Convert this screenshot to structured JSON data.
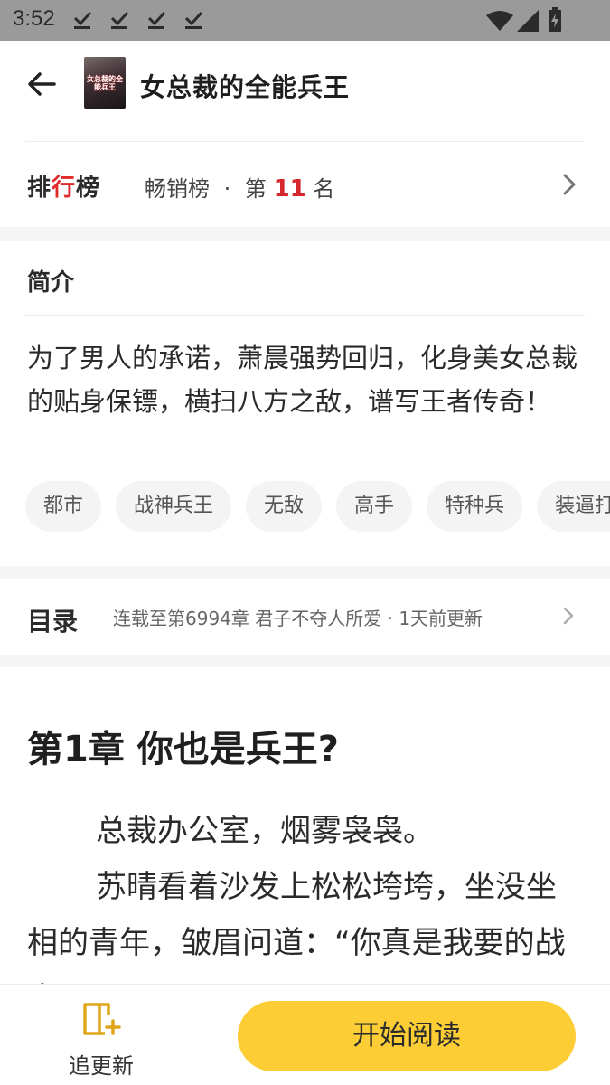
{
  "status_bar": {
    "time": "3:52"
  },
  "header": {
    "book_title": "女总裁的全能兵王",
    "cover_text": "女总裁的全能兵王"
  },
  "ranking": {
    "logo_prefix": "排",
    "logo_accent": "行",
    "logo_suffix": "榜",
    "list_name": "畅销榜",
    "separator": "·",
    "rank_prefix": "第",
    "rank_number": "11",
    "rank_suffix": "名"
  },
  "intro": {
    "title": "简介",
    "text": "为了男人的承诺，萧晨强势回归，化身美女总裁的贴身保镖，横扫八方之敌，谱写王者传奇！",
    "tags": [
      "都市",
      "战神兵王",
      "无敌",
      "高手",
      "特种兵",
      "装逼打脸"
    ]
  },
  "catalog": {
    "title": "目录",
    "info": "连载至第6994章 君子不夺人所爱 · 1天前更新"
  },
  "chapter": {
    "title": "第1章 你也是兵王?",
    "paragraphs": [
      "总裁办公室，烟雾袅袅。",
      "苏晴看着沙发上松松垮垮，坐没坐相的青年，皱眉问道：“你真是我要的战士?”"
    ]
  },
  "bottom_bar": {
    "follow_label": "追更新",
    "read_label": "开始阅读"
  },
  "colors": {
    "accent_yellow": "#fccd35",
    "rank_red": "#d5282c",
    "status_bar": "#9a9a9a"
  }
}
